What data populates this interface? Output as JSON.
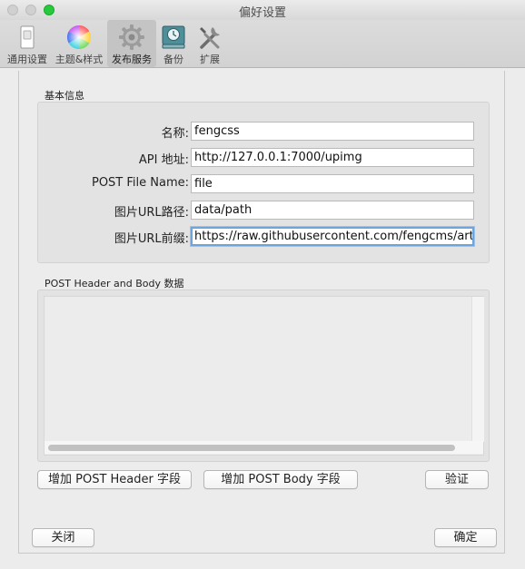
{
  "window": {
    "title": "偏好设置"
  },
  "toolbar": {
    "tabs": [
      {
        "label": "通用设置",
        "icon": "switch-icon",
        "active": false
      },
      {
        "label": "主题&样式",
        "icon": "color-wheel-icon",
        "active": false
      },
      {
        "label": "发布服务",
        "icon": "gear-icon",
        "active": true
      },
      {
        "label": "备份",
        "icon": "time-machine-icon",
        "active": false
      },
      {
        "label": "扩展",
        "icon": "tools-icon",
        "active": false
      }
    ]
  },
  "basic_info": {
    "title": "基本信息",
    "fields": [
      {
        "label": "名称:",
        "value": "fengcss"
      },
      {
        "label": "API 地址:",
        "value": "http://127.0.0.1:7000/upimg"
      },
      {
        "label": "POST File Name:",
        "value": "file"
      },
      {
        "label": "图片URL路径:",
        "value": "data/path"
      },
      {
        "label": "图片URL前缀:",
        "value": "https://raw.githubusercontent.com/fengcms/article"
      }
    ]
  },
  "post_data": {
    "title": "POST Header and Body 数据",
    "content": ""
  },
  "actions": {
    "add_header": "增加 POST Header 字段",
    "add_body": "增加 POST Body 字段",
    "verify": "验证",
    "close": "关闭",
    "confirm": "确定"
  },
  "colors": {
    "focus_ring": "#6ea4dc",
    "maximize": "#27c93f"
  }
}
